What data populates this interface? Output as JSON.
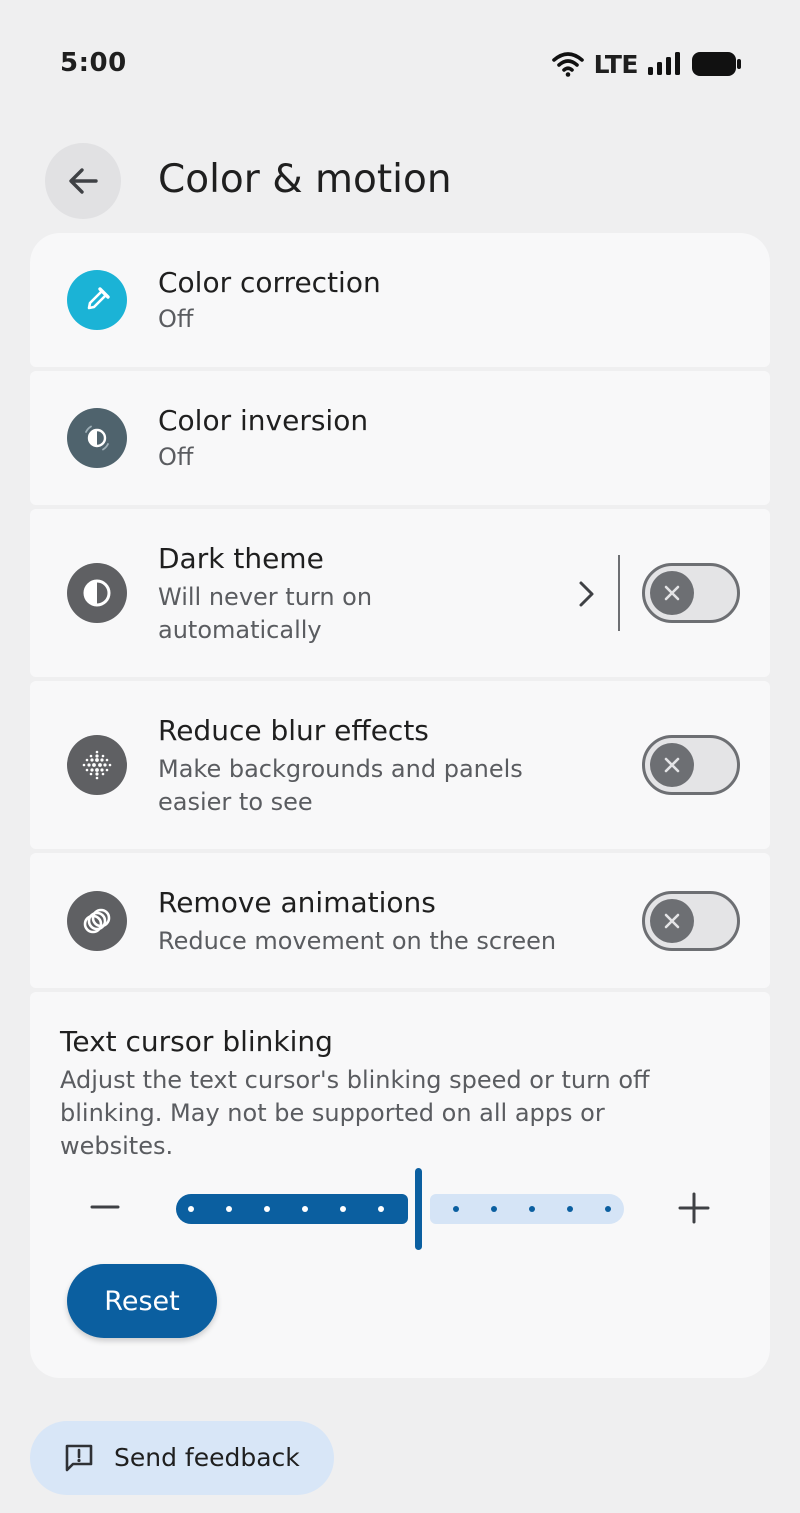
{
  "status_bar": {
    "time": "5:00",
    "network": "LTE",
    "icons": [
      "wifi-icon",
      "cellular-signal-icon",
      "battery-icon"
    ]
  },
  "header": {
    "title": "Color & motion",
    "back_icon": "arrow-back-icon"
  },
  "settings": [
    {
      "title": "Color correction",
      "subtitle": "Off",
      "icon": "eyedropper-icon",
      "icon_color": "#1bb3d6"
    },
    {
      "title": "Color inversion",
      "subtitle": "Off",
      "icon": "color-inversion-icon",
      "icon_color": "#4f636d"
    },
    {
      "title": "Dark theme",
      "subtitle": "Will never turn on automatically",
      "icon": "contrast-icon",
      "icon_color": "#5f6063",
      "toggle_on": false,
      "has_chevron": true
    },
    {
      "title": "Reduce blur effects",
      "subtitle": "Make backgrounds and panels easier to see",
      "icon": "dot-grid-icon",
      "icon_color": "#5f6063",
      "toggle_on": false
    },
    {
      "title": "Remove animations",
      "subtitle": "Reduce movement on the screen",
      "icon": "overlapping-rings-icon",
      "icon_color": "#5f6063",
      "toggle_on": false
    }
  ],
  "text_cursor": {
    "title": "Text cursor blinking",
    "description": "Adjust the text cursor's blinking speed or turn off blinking. May not be supported on all apps or websites.",
    "slider_level_fraction": 0.54,
    "reset_label": "Reset"
  },
  "feedback": {
    "label": "Send feedback",
    "icon": "feedback-icon"
  },
  "colors": {
    "accent": "#0b5fa0",
    "accent_light": "#d5e4f6",
    "background": "#efeff0",
    "card": "#f8f8f9",
    "toggle_off": "#6d6f73"
  }
}
